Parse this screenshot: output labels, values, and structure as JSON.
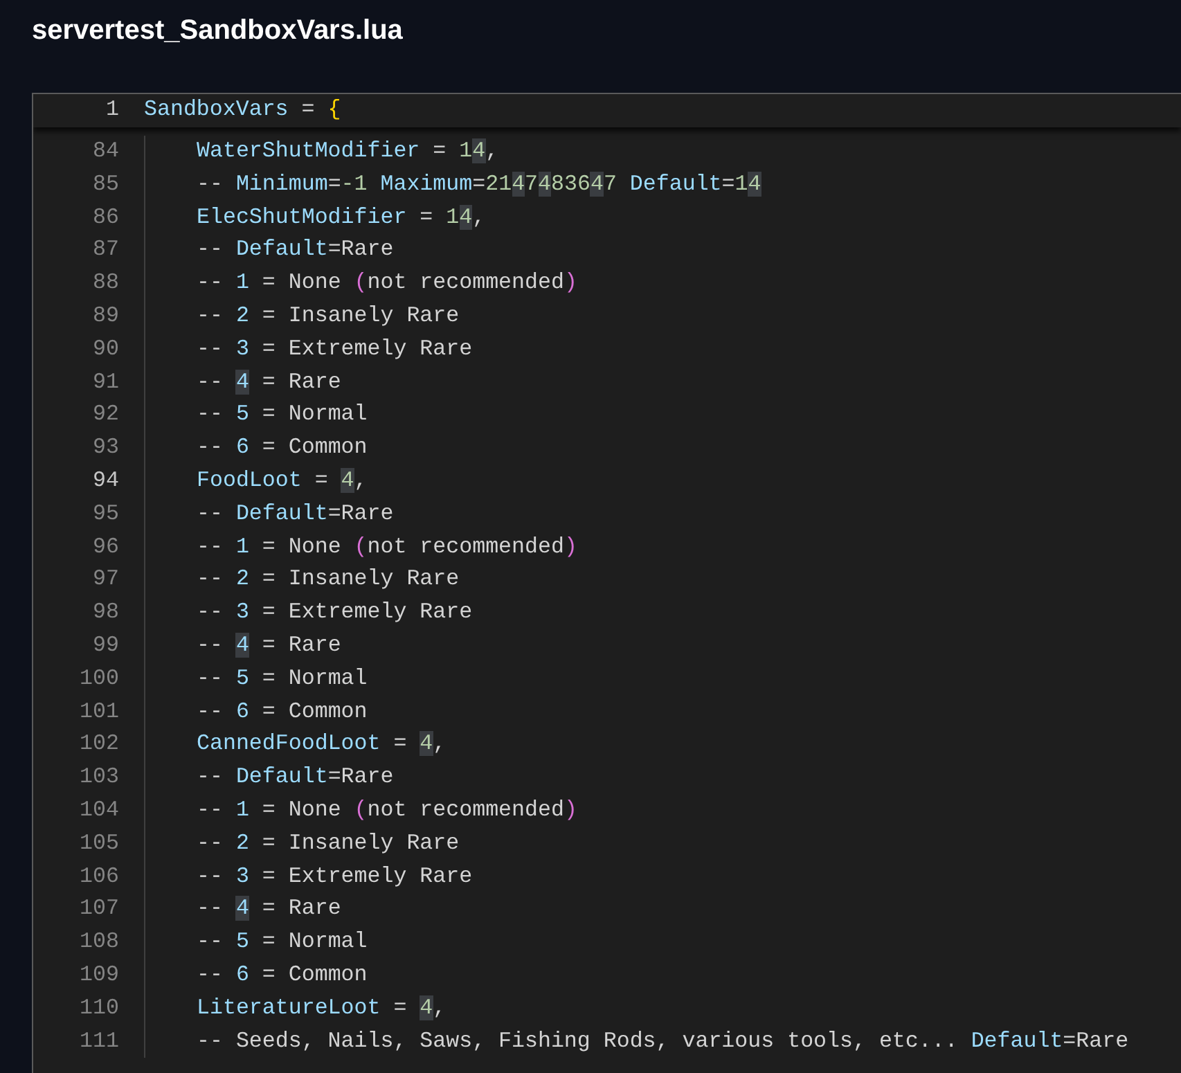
{
  "title": "servertest_SandboxVars.lua",
  "sticky_line": {
    "number": "1",
    "segments": [
      {
        "text": "SandboxVars",
        "kind": "ident",
        "highlighted": false
      },
      {
        "text": " = ",
        "kind": "plain",
        "highlighted": false
      },
      {
        "text": "{",
        "kind": "brace",
        "highlighted": false
      }
    ]
  },
  "lines": [
    {
      "number": "84",
      "current": false,
      "segments": [
        {
          "text": "WaterShutModifier",
          "kind": "ident",
          "highlighted": false
        },
        {
          "text": " = ",
          "kind": "plain",
          "highlighted": false
        },
        {
          "text": "1",
          "kind": "num",
          "highlighted": false
        },
        {
          "text": "4",
          "kind": "num",
          "highlighted": true
        },
        {
          "text": ",",
          "kind": "plain",
          "highlighted": false
        }
      ]
    },
    {
      "number": "85",
      "current": false,
      "segments": [
        {
          "text": "-- ",
          "kind": "plain",
          "highlighted": false
        },
        {
          "text": "Minimum",
          "kind": "ident",
          "highlighted": false
        },
        {
          "text": "=",
          "kind": "plain",
          "highlighted": false
        },
        {
          "text": "-1 ",
          "kind": "num",
          "highlighted": false
        },
        {
          "text": "Maximum",
          "kind": "ident",
          "highlighted": false
        },
        {
          "text": "=",
          "kind": "plain",
          "highlighted": false
        },
        {
          "text": "21",
          "kind": "num",
          "highlighted": false
        },
        {
          "text": "4",
          "kind": "num",
          "highlighted": true
        },
        {
          "text": "7",
          "kind": "num",
          "highlighted": false
        },
        {
          "text": "4",
          "kind": "num",
          "highlighted": true
        },
        {
          "text": "836",
          "kind": "num",
          "highlighted": false
        },
        {
          "text": "4",
          "kind": "num",
          "highlighted": true
        },
        {
          "text": "7 ",
          "kind": "num",
          "highlighted": false
        },
        {
          "text": "Default",
          "kind": "ident",
          "highlighted": false
        },
        {
          "text": "=",
          "kind": "plain",
          "highlighted": false
        },
        {
          "text": "1",
          "kind": "num",
          "highlighted": false
        },
        {
          "text": "4",
          "kind": "num",
          "highlighted": true
        }
      ]
    },
    {
      "number": "86",
      "current": false,
      "segments": [
        {
          "text": "ElecShutModifier",
          "kind": "ident",
          "highlighted": false
        },
        {
          "text": " = ",
          "kind": "plain",
          "highlighted": false
        },
        {
          "text": "1",
          "kind": "num",
          "highlighted": false
        },
        {
          "text": "4",
          "kind": "num",
          "highlighted": true
        },
        {
          "text": ",",
          "kind": "plain",
          "highlighted": false
        }
      ]
    },
    {
      "number": "87",
      "current": false,
      "segments": [
        {
          "text": "-- ",
          "kind": "plain",
          "highlighted": false
        },
        {
          "text": "Default",
          "kind": "ident",
          "highlighted": false
        },
        {
          "text": "=Rare",
          "kind": "plain",
          "highlighted": false
        }
      ]
    },
    {
      "number": "88",
      "current": false,
      "segments": [
        {
          "text": "-- ",
          "kind": "plain",
          "highlighted": false
        },
        {
          "text": "1",
          "kind": "ident",
          "highlighted": false
        },
        {
          "text": " = None ",
          "kind": "plain",
          "highlighted": false
        },
        {
          "text": "(",
          "kind": "paren",
          "highlighted": false
        },
        {
          "text": "not recommended",
          "kind": "plain",
          "highlighted": false
        },
        {
          "text": ")",
          "kind": "paren",
          "highlighted": false
        }
      ]
    },
    {
      "number": "89",
      "current": false,
      "segments": [
        {
          "text": "-- ",
          "kind": "plain",
          "highlighted": false
        },
        {
          "text": "2",
          "kind": "ident",
          "highlighted": false
        },
        {
          "text": " = Insanely Rare",
          "kind": "plain",
          "highlighted": false
        }
      ]
    },
    {
      "number": "90",
      "current": false,
      "segments": [
        {
          "text": "-- ",
          "kind": "plain",
          "highlighted": false
        },
        {
          "text": "3",
          "kind": "ident",
          "highlighted": false
        },
        {
          "text": " = Extremely Rare",
          "kind": "plain",
          "highlighted": false
        }
      ]
    },
    {
      "number": "91",
      "current": false,
      "segments": [
        {
          "text": "-- ",
          "kind": "plain",
          "highlighted": false
        },
        {
          "text": "4",
          "kind": "ident",
          "highlighted": true
        },
        {
          "text": " = Rare",
          "kind": "plain",
          "highlighted": false
        }
      ]
    },
    {
      "number": "92",
      "current": false,
      "segments": [
        {
          "text": "-- ",
          "kind": "plain",
          "highlighted": false
        },
        {
          "text": "5",
          "kind": "ident",
          "highlighted": false
        },
        {
          "text": " = Normal",
          "kind": "plain",
          "highlighted": false
        }
      ]
    },
    {
      "number": "93",
      "current": false,
      "segments": [
        {
          "text": "-- ",
          "kind": "plain",
          "highlighted": false
        },
        {
          "text": "6",
          "kind": "ident",
          "highlighted": false
        },
        {
          "text": " = Common",
          "kind": "plain",
          "highlighted": false
        }
      ]
    },
    {
      "number": "94",
      "current": true,
      "segments": [
        {
          "text": "FoodLoot",
          "kind": "ident",
          "highlighted": false
        },
        {
          "text": " = ",
          "kind": "plain",
          "highlighted": false
        },
        {
          "text": "4",
          "kind": "num",
          "highlighted": true
        },
        {
          "text": ",",
          "kind": "plain",
          "highlighted": false
        }
      ]
    },
    {
      "number": "95",
      "current": false,
      "segments": [
        {
          "text": "-- ",
          "kind": "plain",
          "highlighted": false
        },
        {
          "text": "Default",
          "kind": "ident",
          "highlighted": false
        },
        {
          "text": "=Rare",
          "kind": "plain",
          "highlighted": false
        }
      ]
    },
    {
      "number": "96",
      "current": false,
      "segments": [
        {
          "text": "-- ",
          "kind": "plain",
          "highlighted": false
        },
        {
          "text": "1",
          "kind": "ident",
          "highlighted": false
        },
        {
          "text": " = None ",
          "kind": "plain",
          "highlighted": false
        },
        {
          "text": "(",
          "kind": "paren",
          "highlighted": false
        },
        {
          "text": "not recommended",
          "kind": "plain",
          "highlighted": false
        },
        {
          "text": ")",
          "kind": "paren",
          "highlighted": false
        }
      ]
    },
    {
      "number": "97",
      "current": false,
      "segments": [
        {
          "text": "-- ",
          "kind": "plain",
          "highlighted": false
        },
        {
          "text": "2",
          "kind": "ident",
          "highlighted": false
        },
        {
          "text": " = Insanely Rare",
          "kind": "plain",
          "highlighted": false
        }
      ]
    },
    {
      "number": "98",
      "current": false,
      "segments": [
        {
          "text": "-- ",
          "kind": "plain",
          "highlighted": false
        },
        {
          "text": "3",
          "kind": "ident",
          "highlighted": false
        },
        {
          "text": " = Extremely Rare",
          "kind": "plain",
          "highlighted": false
        }
      ]
    },
    {
      "number": "99",
      "current": false,
      "segments": [
        {
          "text": "-- ",
          "kind": "plain",
          "highlighted": false
        },
        {
          "text": "4",
          "kind": "ident",
          "highlighted": true
        },
        {
          "text": " = Rare",
          "kind": "plain",
          "highlighted": false
        }
      ]
    },
    {
      "number": "100",
      "current": false,
      "segments": [
        {
          "text": "-- ",
          "kind": "plain",
          "highlighted": false
        },
        {
          "text": "5",
          "kind": "ident",
          "highlighted": false
        },
        {
          "text": " = Normal",
          "kind": "plain",
          "highlighted": false
        }
      ]
    },
    {
      "number": "101",
      "current": false,
      "segments": [
        {
          "text": "-- ",
          "kind": "plain",
          "highlighted": false
        },
        {
          "text": "6",
          "kind": "ident",
          "highlighted": false
        },
        {
          "text": " = Common",
          "kind": "plain",
          "highlighted": false
        }
      ]
    },
    {
      "number": "102",
      "current": false,
      "segments": [
        {
          "text": "CannedFoodLoot",
          "kind": "ident",
          "highlighted": false
        },
        {
          "text": " = ",
          "kind": "plain",
          "highlighted": false
        },
        {
          "text": "4",
          "kind": "num",
          "highlighted": true
        },
        {
          "text": ",",
          "kind": "plain",
          "highlighted": false
        }
      ]
    },
    {
      "number": "103",
      "current": false,
      "segments": [
        {
          "text": "-- ",
          "kind": "plain",
          "highlighted": false
        },
        {
          "text": "Default",
          "kind": "ident",
          "highlighted": false
        },
        {
          "text": "=Rare",
          "kind": "plain",
          "highlighted": false
        }
      ]
    },
    {
      "number": "104",
      "current": false,
      "segments": [
        {
          "text": "-- ",
          "kind": "plain",
          "highlighted": false
        },
        {
          "text": "1",
          "kind": "ident",
          "highlighted": false
        },
        {
          "text": " = None ",
          "kind": "plain",
          "highlighted": false
        },
        {
          "text": "(",
          "kind": "paren",
          "highlighted": false
        },
        {
          "text": "not recommended",
          "kind": "plain",
          "highlighted": false
        },
        {
          "text": ")",
          "kind": "paren",
          "highlighted": false
        }
      ]
    },
    {
      "number": "105",
      "current": false,
      "segments": [
        {
          "text": "-- ",
          "kind": "plain",
          "highlighted": false
        },
        {
          "text": "2",
          "kind": "ident",
          "highlighted": false
        },
        {
          "text": " = Insanely Rare",
          "kind": "plain",
          "highlighted": false
        }
      ]
    },
    {
      "number": "106",
      "current": false,
      "segments": [
        {
          "text": "-- ",
          "kind": "plain",
          "highlighted": false
        },
        {
          "text": "3",
          "kind": "ident",
          "highlighted": false
        },
        {
          "text": " = Extremely Rare",
          "kind": "plain",
          "highlighted": false
        }
      ]
    },
    {
      "number": "107",
      "current": false,
      "segments": [
        {
          "text": "-- ",
          "kind": "plain",
          "highlighted": false
        },
        {
          "text": "4",
          "kind": "ident",
          "highlighted": true
        },
        {
          "text": " = Rare",
          "kind": "plain",
          "highlighted": false
        }
      ]
    },
    {
      "number": "108",
      "current": false,
      "segments": [
        {
          "text": "-- ",
          "kind": "plain",
          "highlighted": false
        },
        {
          "text": "5",
          "kind": "ident",
          "highlighted": false
        },
        {
          "text": " = Normal",
          "kind": "plain",
          "highlighted": false
        }
      ]
    },
    {
      "number": "109",
      "current": false,
      "segments": [
        {
          "text": "-- ",
          "kind": "plain",
          "highlighted": false
        },
        {
          "text": "6",
          "kind": "ident",
          "highlighted": false
        },
        {
          "text": " = Common",
          "kind": "plain",
          "highlighted": false
        }
      ]
    },
    {
      "number": "110",
      "current": false,
      "segments": [
        {
          "text": "LiteratureLoot",
          "kind": "ident",
          "highlighted": false
        },
        {
          "text": " = ",
          "kind": "plain",
          "highlighted": false
        },
        {
          "text": "4",
          "kind": "num",
          "highlighted": true
        },
        {
          "text": ",",
          "kind": "plain",
          "highlighted": false
        }
      ]
    },
    {
      "number": "111",
      "current": false,
      "segments": [
        {
          "text": "-- Seeds, Nails, Saws, Fishing Rods, various tools, etc... ",
          "kind": "plain",
          "highlighted": false
        },
        {
          "text": "Default",
          "kind": "ident",
          "highlighted": false
        },
        {
          "text": "=Rare",
          "kind": "plain",
          "highlighted": false
        }
      ]
    }
  ]
}
